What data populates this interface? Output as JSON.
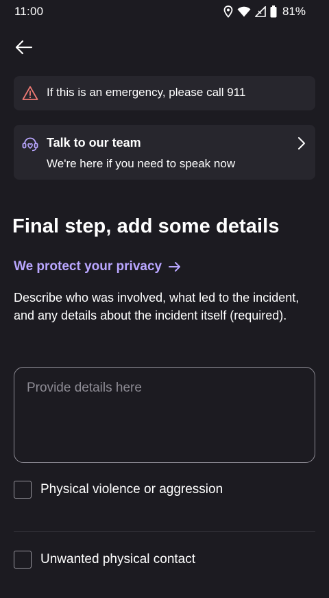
{
  "status_bar": {
    "time": "11:00",
    "battery": "81%"
  },
  "emergency": {
    "text": "If this is an emergency, please call 911",
    "icon": "warning-triangle-icon",
    "icon_color": "#f07a74"
  },
  "team": {
    "title": "Talk to our team",
    "subtitle": "We're here if you need to speak now",
    "icon": "headset-heart-icon",
    "icon_color": "#b9a6ff"
  },
  "page": {
    "title": "Final step, add some details",
    "privacy_link": "We protect your privacy",
    "privacy_link_color": "#b9a6ff",
    "description": "Describe who was involved, what led to the incident, and any details about the incident itself (required)."
  },
  "details": {
    "placeholder": "Provide details here",
    "value": ""
  },
  "options": [
    {
      "label": "Physical violence or aggression",
      "checked": false
    },
    {
      "label": "Unwanted physical contact",
      "checked": false
    }
  ],
  "colors": {
    "background": "#1c1b21",
    "card": "#27262d",
    "accent": "#b9a6ff"
  }
}
